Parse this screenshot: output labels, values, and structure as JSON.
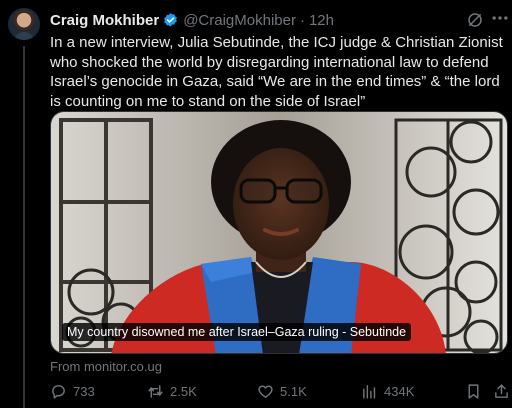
{
  "author": {
    "name": "Craig Mokhiber",
    "handle": "@CraigMokhiber",
    "separator": "·",
    "time": "12h"
  },
  "tweet": {
    "text": "In a new interview, Julia Sebutinde, the ICJ judge & Christian Zionist who shocked the world by disregarding international law to defend Israel’s genocide in Gaza, said “We are in the end times” & “the lord is counting on me to stand on the side of Israel”"
  },
  "media": {
    "caption": "My country disowned me after Israel–Gaza ruling - Sebutinde",
    "source": "From monitor.co.ug"
  },
  "actions": {
    "replies": "733",
    "reposts": "2.5K",
    "likes": "5.1K",
    "views": "434K"
  },
  "icons": {
    "verified": "verified-badge-icon",
    "grok": "grok-icon",
    "more": "more-icon",
    "reply": "reply-icon",
    "repost": "repost-icon",
    "like": "like-icon",
    "views": "views-icon",
    "bookmark": "bookmark-icon",
    "share": "share-icon"
  },
  "colors": {
    "background": "#000000",
    "text": "#e7e9ea",
    "secondary": "#71767b",
    "verified": "#1d9bf0"
  }
}
